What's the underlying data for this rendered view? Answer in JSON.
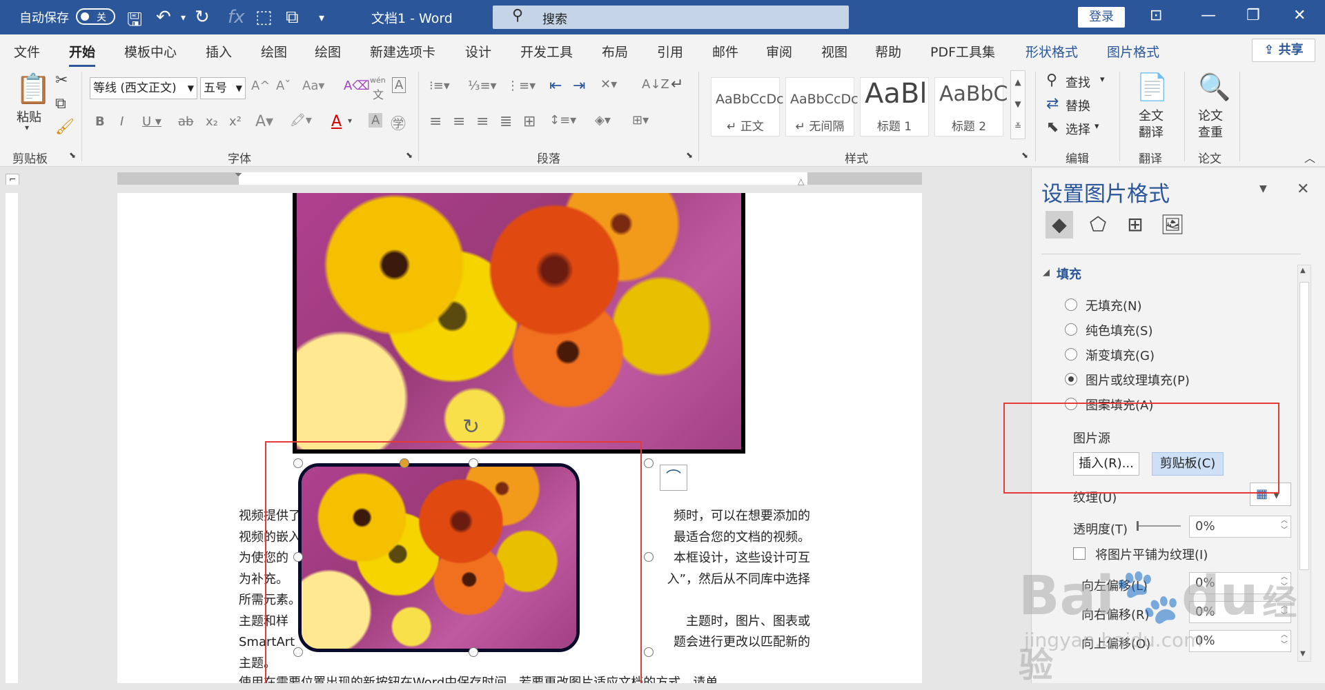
{
  "titlebar": {
    "autosave_label": "自动保存",
    "autosave_state": "关",
    "doc_title": "文档1  -  Word",
    "search_placeholder": "搜索",
    "login_label": "登录"
  },
  "tabs": [
    {
      "label": "文件"
    },
    {
      "label": "开始"
    },
    {
      "label": "模板中心"
    },
    {
      "label": "插入"
    },
    {
      "label": "绘图"
    },
    {
      "label": "绘图"
    },
    {
      "label": "新建选项卡"
    },
    {
      "label": "设计"
    },
    {
      "label": "开发工具"
    },
    {
      "label": "布局"
    },
    {
      "label": "引用"
    },
    {
      "label": "邮件"
    },
    {
      "label": "审阅"
    },
    {
      "label": "视图"
    },
    {
      "label": "帮助"
    },
    {
      "label": "PDF工具集"
    },
    {
      "label": "形状格式"
    },
    {
      "label": "图片格式"
    }
  ],
  "share_label": "共享",
  "ribbon": {
    "clipboard": {
      "paste": "粘贴",
      "group": "剪贴板"
    },
    "font": {
      "name": "等线 (西文正文)",
      "size": "五号",
      "group": "字体",
      "wen": "wén",
      "wen_char": "文"
    },
    "paragraph": {
      "group": "段落"
    },
    "styles": {
      "group": "样式",
      "items": [
        {
          "sample": "AaBbCcDc",
          "name": "↵ 正文"
        },
        {
          "sample": "AaBbCcDc",
          "name": "↵ 无间隔"
        },
        {
          "sample": "AaBl",
          "name": "标题 1"
        },
        {
          "sample": "AaBbC",
          "name": "标题 2"
        }
      ]
    },
    "editing": {
      "find": "查找",
      "replace": "替换",
      "select": "选择",
      "group": "编辑"
    },
    "translate": {
      "label_line1": "全文",
      "label_line2": "翻译",
      "group": "翻译"
    },
    "paper": {
      "label_line1": "论文",
      "label_line2": "查重",
      "group": "论文"
    }
  },
  "document": {
    "lines": [
      "视频提供了",
      "频时，可以在想要添加的",
      "视频的嵌入",
      "最适合您的文档的视频。",
      "为使您的",
      "本框设计，这些设计可互",
      "为补充。",
      "入”，然后从不同库中选择",
      "所需元素。",
      "主题和样",
      "主题时，图片、图表或",
      "SmartArt",
      "题会进行更改以匹配新的",
      "主题。",
      "使用在需要位置出现的新按钮在Word中保存时间。若要更改图片适应文档的方式，请单"
    ]
  },
  "pane": {
    "title": "设置图片格式",
    "section": "填充",
    "options": [
      {
        "label": "无填充(N)",
        "checked": false
      },
      {
        "label": "纯色填充(S)",
        "checked": false
      },
      {
        "label": "渐变填充(G)",
        "checked": false
      },
      {
        "label": "图片或纹理填充(P)",
        "checked": true
      },
      {
        "label": "图案填充(A)",
        "checked": false
      }
    ],
    "source_label": "图片源",
    "insert_button": "插入(R)...",
    "clipboard_button": "剪贴板(C)",
    "texture_label": "纹理(U)",
    "transparency_label": "透明度(T)",
    "transparency_value": "0%",
    "tile_label": "将图片平铺为纹理(I)",
    "offsets": [
      {
        "label": "向左偏移(L)",
        "value": "0%"
      },
      {
        "label": "向右偏移(R)",
        "value": "0%"
      },
      {
        "label": "向上偏移(O)",
        "value": "0%"
      }
    ]
  },
  "watermark": {
    "main": "Bai",
    "paw": "du",
    "cn": "经验",
    "url": "jingyan.baidu.com"
  },
  "colors": {
    "accent": "#2b579a",
    "highlight_box": "#e53935"
  }
}
